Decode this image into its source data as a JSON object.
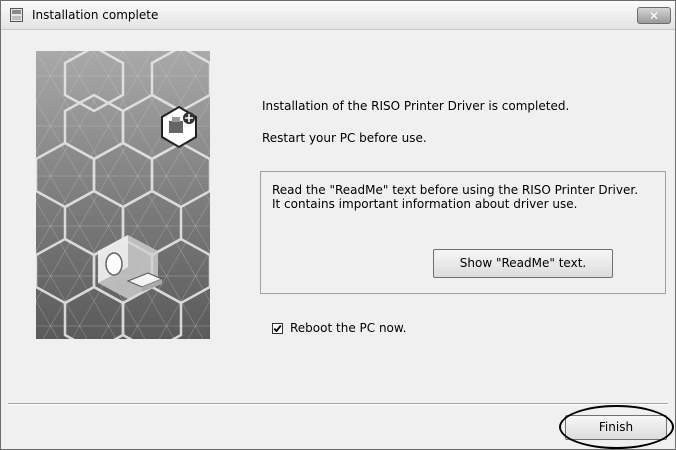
{
  "window": {
    "title": "Installation complete",
    "close_glyph": "✕"
  },
  "main": {
    "message_completed": "Installation of the RISO Printer Driver is completed.",
    "message_restart": "Restart your PC before use.",
    "readme_info": "Read the \"ReadMe\" text before using the RISO Printer Driver.\nIt contains important information about driver use.",
    "readme_button": "Show \"ReadMe\" text.",
    "reboot_label": "Reboot the PC now.",
    "reboot_checked": true
  },
  "footer": {
    "finish_button": "Finish"
  },
  "icons": {
    "app": "installer-icon",
    "close": "close-icon",
    "banner": "hexagon-banner-image",
    "printer": "printer-icon"
  }
}
